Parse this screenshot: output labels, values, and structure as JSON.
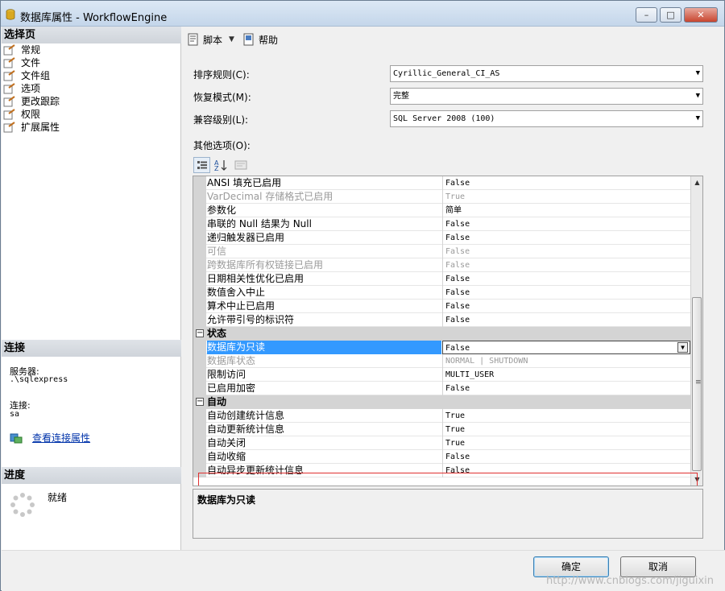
{
  "window": {
    "title": "数据库属性 - WorkflowEngine",
    "controls": {
      "minimize": "–",
      "maximize": "□",
      "close": "✕"
    }
  },
  "left": {
    "select_page_header": "选择页",
    "pages": [
      {
        "label": "常规"
      },
      {
        "label": "文件"
      },
      {
        "label": "文件组"
      },
      {
        "label": "选项"
      },
      {
        "label": "更改跟踪"
      },
      {
        "label": "权限"
      },
      {
        "label": "扩展属性"
      }
    ],
    "connection_header": "连接",
    "server_label": "服务器:",
    "server_value": ".\\sqlexpress",
    "conn_label": "连接:",
    "conn_value": "sa",
    "view_conn_link": "查看连接属性",
    "progress_header": "进度",
    "progress_status": "就绪"
  },
  "toolbar": {
    "script_label": "脚本",
    "help_label": "帮助"
  },
  "form": {
    "collation_label": "排序规则(C):",
    "collation_value": "Cyrillic_General_CI_AS",
    "recovery_label": "恢复模式(M):",
    "recovery_value": "完整",
    "compat_label": "兼容级别(L):",
    "compat_value": "SQL Server 2008 (100)",
    "other_options_label": "其他选项(O):"
  },
  "grid": {
    "rows": [
      {
        "kind": "prop",
        "name": "ANSI 填充已启用",
        "value": "False",
        "disabled": false
      },
      {
        "kind": "prop",
        "name": "VarDecimal 存储格式已启用",
        "value": "True",
        "disabled": true
      },
      {
        "kind": "prop",
        "name": "参数化",
        "value": "简单",
        "disabled": false
      },
      {
        "kind": "prop",
        "name": "串联的 Null 结果为 Null",
        "value": "False",
        "disabled": false
      },
      {
        "kind": "prop",
        "name": "递归触发器已启用",
        "value": "False",
        "disabled": false
      },
      {
        "kind": "prop",
        "name": "可信",
        "value": "False",
        "disabled": true
      },
      {
        "kind": "prop",
        "name": "跨数据库所有权链接已启用",
        "value": "False",
        "disabled": true
      },
      {
        "kind": "prop",
        "name": "日期相关性优化已启用",
        "value": "False",
        "disabled": false
      },
      {
        "kind": "prop",
        "name": "数值舍入中止",
        "value": "False",
        "disabled": false
      },
      {
        "kind": "prop",
        "name": "算术中止已启用",
        "value": "False",
        "disabled": false
      },
      {
        "kind": "prop",
        "name": "允许带引号的标识符",
        "value": "False",
        "disabled": false
      },
      {
        "kind": "cat",
        "name": "状态",
        "expander": "⊟"
      },
      {
        "kind": "prop",
        "name": "数据库为只读",
        "value": "False",
        "disabled": false,
        "selected": true
      },
      {
        "kind": "prop",
        "name": "数据库状态",
        "value": "NORMAL | SHUTDOWN",
        "disabled": true
      },
      {
        "kind": "prop",
        "name": "限制访问",
        "value": "MULTI_USER",
        "disabled": false
      },
      {
        "kind": "prop",
        "name": "已启用加密",
        "value": "False",
        "disabled": false
      },
      {
        "kind": "cat",
        "name": "自动",
        "expander": "⊟"
      },
      {
        "kind": "prop",
        "name": "自动创建统计信息",
        "value": "True",
        "disabled": false
      },
      {
        "kind": "prop",
        "name": "自动更新统计信息",
        "value": "True",
        "disabled": false
      },
      {
        "kind": "prop",
        "name": "自动关闭",
        "value": "True",
        "disabled": false
      },
      {
        "kind": "prop",
        "name": "自动收缩",
        "value": "False",
        "disabled": false
      },
      {
        "kind": "prop",
        "name": "自动异步更新统计信息",
        "value": "False",
        "disabled": false
      }
    ]
  },
  "description": {
    "title": "数据库为只读"
  },
  "buttons": {
    "ok": "确定",
    "cancel": "取消"
  },
  "watermark": "http://www.cnblogs.com/jiguixin",
  "colors": {
    "selection": "#3399ff",
    "highlight_border": "#e03030",
    "link": "#0033aa"
  }
}
